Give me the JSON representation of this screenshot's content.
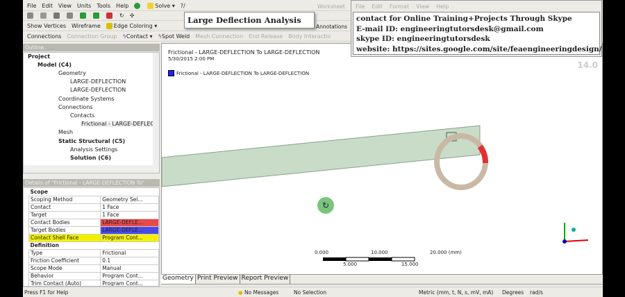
{
  "menu": [
    "File",
    "Edit",
    "View",
    "Units",
    "Tools",
    "Help"
  ],
  "toolbar": {
    "solve": "Solve",
    "help": "?/",
    "show_vertices": "Show Vertices",
    "wireframe": "Wireframe",
    "edge_coloring": "Edge Coloring",
    "annotations": "Annotations",
    "worksheet": "Worksheet"
  },
  "conn_toolbar": [
    "Connections",
    "Connection Group",
    "Contact",
    "Spot Weld",
    "Mesh Connection",
    "End Release",
    "Body Interactio"
  ],
  "title_overlay": "Large Deflection Analysis",
  "notepad": {
    "menu": [
      "File",
      "Edit",
      "Format",
      "View",
      "Help"
    ],
    "lines": [
      "contact for Online Training+Projects Through Skype",
      "E-mail ID: engineeringtutorsdesk@gmail.com",
      "skype ID: engineeringtutorsdesk",
      "website: https://sites.google.com/site/feaengineeringdesign/"
    ]
  },
  "outline": {
    "title": "Outline",
    "items": [
      "Project",
      "Model (C4)",
      "Geometry",
      "LARGE-DEFLECTION",
      "LARGE-DEFLECTION",
      "Coordinate Systems",
      "Connections",
      "Contacts",
      "Frictional - LARGE-DEFLEC",
      "Mesh",
      "Static Structural (C5)",
      "Analysis Settings",
      "Solution (C6)"
    ]
  },
  "details": {
    "title": "Details of \"Frictional - LARGE-DEFLECTION To\"",
    "rows": [
      [
        "Scope",
        ""
      ],
      [
        "Scoping Method",
        "Geometry Sel..."
      ],
      [
        "Contact",
        "1 Face"
      ],
      [
        "Target",
        "1 Face"
      ],
      [
        "Contact Bodies",
        "LARGE-DEFLE..."
      ],
      [
        "Target Bodies",
        "LARGE-DEFLE..."
      ],
      [
        "Contact Shell Face",
        "Program Cont..."
      ],
      [
        "Definition",
        ""
      ],
      [
        "Type",
        "Frictional"
      ],
      [
        "Friction Coefficient",
        "0.1"
      ],
      [
        "Scope Mode",
        "Manual"
      ],
      [
        "Behavior",
        "Program Cont..."
      ],
      [
        "Trim Contact (Auto)",
        "Program Cont..."
      ]
    ]
  },
  "viewport": {
    "title": "Frictional - LARGE-DEFLECTION To LARGE-DEFLECTION",
    "date": "5/30/2015 2:00 PM",
    "legend": "Frictional - LARGE-DEFLECTION To LARGE-DEFLECTION",
    "version": "14.0",
    "scale_top": [
      "0.000",
      "10.000",
      "20.000 (mm)"
    ],
    "scale_bottom": [
      "5.000",
      "15.000"
    ],
    "legend_color": "#2020ff"
  },
  "tabs": [
    "Geometry",
    "Print Preview",
    "Report Preview"
  ],
  "status": {
    "help": "Press F1 for Help",
    "messages": "No Messages",
    "selection": "No Selection",
    "units": "Metric (mm, t, N, s, mV, mA)",
    "angle": "Degrees",
    "rate": "rad/s"
  }
}
